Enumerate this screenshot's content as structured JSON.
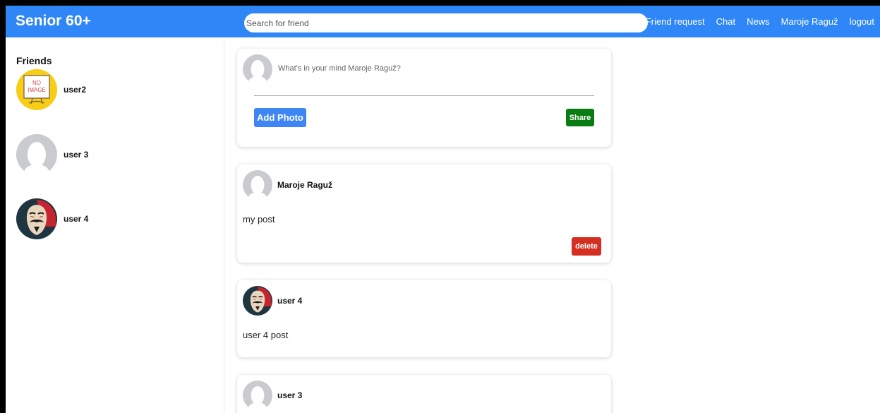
{
  "navbar": {
    "brand": "Senior 60+",
    "search_placeholder": "Search for friend",
    "links": [
      "Friend request",
      "Chat",
      "News",
      "Maroje Raguž",
      "logout"
    ]
  },
  "sidebar": {
    "title": "Friends",
    "friends": [
      {
        "name": "user2",
        "avatar": "no-image-placeholder",
        "avatar_text": [
          "NO",
          "IMAGE"
        ]
      },
      {
        "name": "user 3",
        "avatar": "default-avatar"
      },
      {
        "name": "user 4",
        "avatar": "mask-avatar"
      }
    ]
  },
  "composer": {
    "placeholder": "What's in your mind Maroje Raguž?",
    "add_photo_label": "Add Photo",
    "share_label": "Share"
  },
  "posts": [
    {
      "author": "Maroje Raguž",
      "body": "my post",
      "avatar": "default-avatar",
      "delete_label": "delete"
    },
    {
      "author": "user 4",
      "body": "user 4 post",
      "avatar": "mask-avatar"
    },
    {
      "author": "user 3",
      "body": "",
      "avatar": "default-avatar"
    }
  ],
  "colors": {
    "navbar": "#2f86f6",
    "add_photo": "#3f86f4",
    "share": "#0a7d12",
    "delete": "#d32f23"
  }
}
